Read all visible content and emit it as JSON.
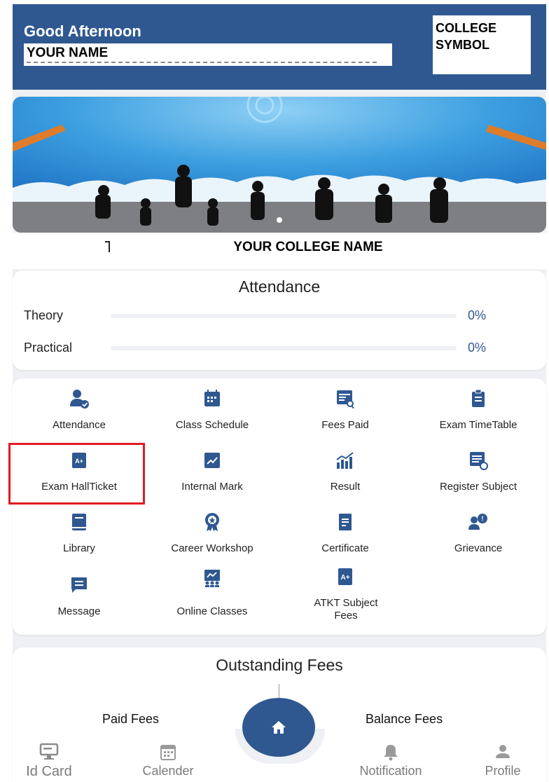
{
  "header": {
    "greeting": "Good Afternoon",
    "name": "YOUR NAME",
    "symbol": "COLLEGE\nSYMBOL"
  },
  "banner": {
    "college_name": "YOUR COLLEGE NAME"
  },
  "attendance": {
    "title": "Attendance",
    "rows": [
      {
        "label": "Theory",
        "value_text": "0%",
        "value": 0
      },
      {
        "label": "Practical",
        "value_text": "0%",
        "value": 0
      }
    ]
  },
  "menu": {
    "items": [
      {
        "label": "Attendance",
        "icon": "user-check-icon"
      },
      {
        "label": "Class Schedule",
        "icon": "calendar-grid-icon"
      },
      {
        "label": "Fees Paid",
        "icon": "receipt-search-icon"
      },
      {
        "label": "Exam TimeTable",
        "icon": "clipboard-icon"
      },
      {
        "label": "Exam HallTicket",
        "icon": "hallticket-icon"
      },
      {
        "label": "Internal Mark",
        "icon": "trend-icon"
      },
      {
        "label": "Result",
        "icon": "bar-chart-icon"
      },
      {
        "label": "Register Subject",
        "icon": "register-list-icon"
      },
      {
        "label": "Library",
        "icon": "book-icon"
      },
      {
        "label": "Career Workshop",
        "icon": "award-badge-icon"
      },
      {
        "label": "Certificate",
        "icon": "certificate-icon"
      },
      {
        "label": "Grievance",
        "icon": "users-chat-icon"
      },
      {
        "label": "Message",
        "icon": "message-icon"
      },
      {
        "label": "Online Classes",
        "icon": "online-class-icon"
      },
      {
        "label": "ATKT Subject Fees",
        "icon": "grade-doc-icon"
      }
    ]
  },
  "fees": {
    "title": "Outstanding Fees",
    "paid_label": "Paid Fees",
    "balance_label": "Balance Fees"
  },
  "nav": {
    "items": [
      {
        "label": "Id Card",
        "icon": "id-card-icon"
      },
      {
        "label": "Calender",
        "icon": "calendar-icon"
      },
      {
        "label": "Notification",
        "icon": "bell-icon"
      },
      {
        "label": "Profile",
        "icon": "profile-icon"
      }
    ],
    "home_icon": "home-icon"
  },
  "colors": {
    "primary": "#2f5891",
    "highlight": "#e11b22",
    "background": "#eef0f3"
  }
}
